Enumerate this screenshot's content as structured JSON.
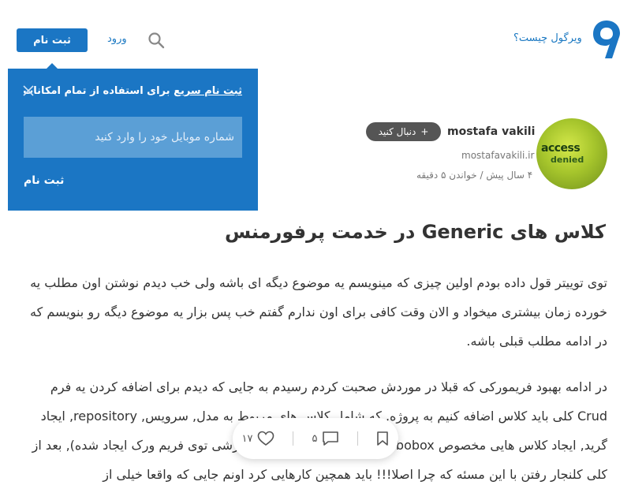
{
  "header": {
    "what_is_link": "ویرگول چیست؟",
    "login_label": "ورود",
    "signup_label": "ثبت نام"
  },
  "popup": {
    "title_highlight": "ثبت نام سریع",
    "title_rest": " برای استفاده از تمام امکانات",
    "phone_placeholder": "شماره موبایل خود را وارد کنید",
    "submit_label": "ثبت نام"
  },
  "author": {
    "avatar_line1": "access",
    "avatar_line2": "denied",
    "name": "mostafa vakili",
    "follow_label": "دنبال کنید",
    "follow_plus": "+",
    "site": "mostafavakili.ir",
    "meta": "۴ سال پیش / خواندن ۵ دقیقه"
  },
  "article": {
    "title": "کلاس های Generic در خدمت پرفورمنس",
    "paragraph_1": "توی توییتر قول داده بودم اولین چیزی که مینویسم یه موضوع دیگه ای باشه ولی خب دیدم نوشتن اون مطلب یه خورده زمان بیشتری میخواد و الان وقت کافی برای اون ندارم گفتم خب پس بزار یه موضوع دیگه رو بنویسم که در ادامه مطلب قبلی باشه.",
    "paragraph_2": "در ادامه بهبود فریمورکی که قبلا در موردش صحبت کردم رسیدم به جایی که دیدم برای اضافه کردن یه فرم Crud کلی باید کلاس اضافه کنیم به پروژه, که شامل کلاس های مربوط به مدل, سرویس, repository, ایجاد گرید, ایجاد کلاس هایی مخصوص combobox ها و ... بود که کاملا سفارشی توی فریم ورک ایجاد شده), بعد از کلی کلنجار رفتن با این مسئه که چرا اصلا!!! باید همچین کارهایی کرد اونم جایی که واقعا خیلی از"
  },
  "actions": {
    "like_count": "۱۷",
    "comment_count": "۵"
  },
  "colors": {
    "brand_blue": "#1b76c4",
    "link_blue": "#1a78c2"
  }
}
